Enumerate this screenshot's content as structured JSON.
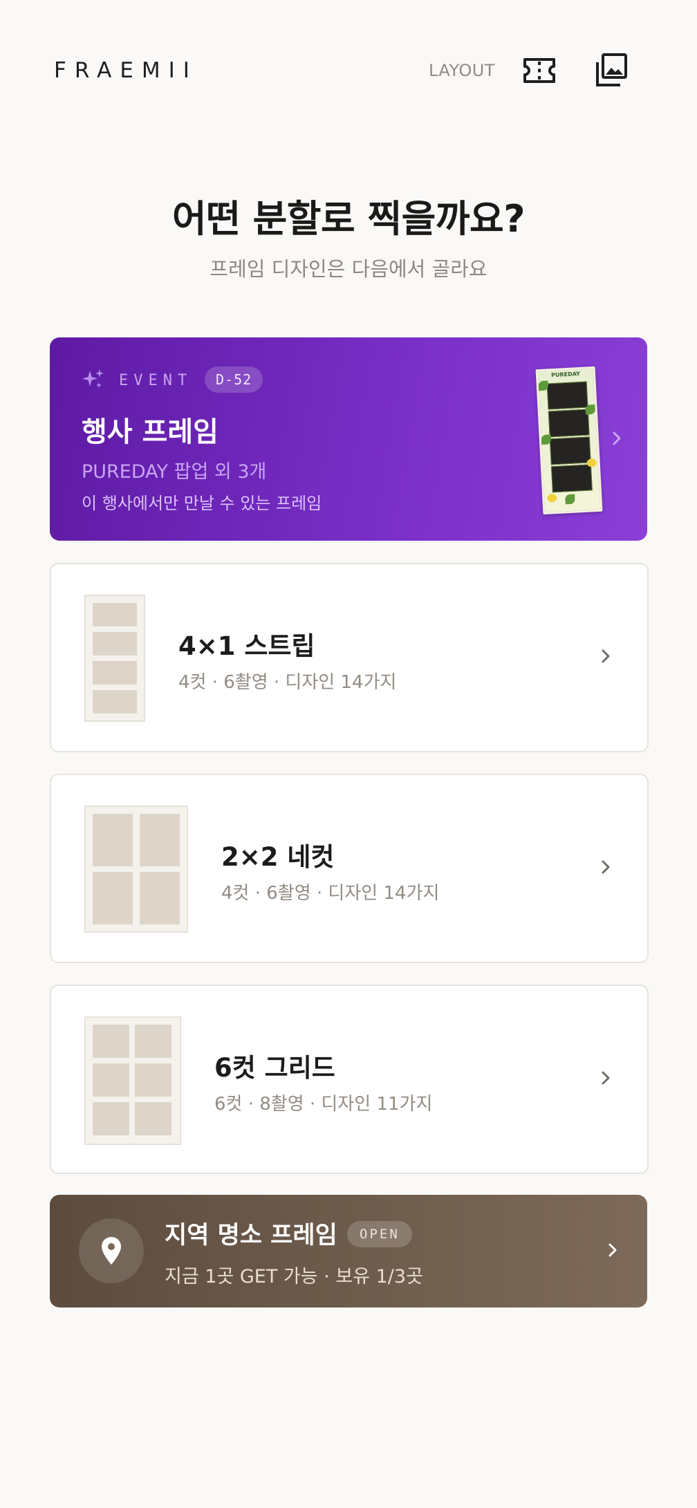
{
  "header": {
    "logo": "FRAEMII",
    "layout_link": "LAYOUT",
    "ticket_icon": "ticket-icon",
    "gallery_icon": "photo-gallery-icon"
  },
  "page": {
    "title": "어떤 분할로 찍을까요?",
    "subtitle": "프레임 디자인은 다음에서 골라요"
  },
  "event_card": {
    "tag": "EVENT",
    "dday": "D-52",
    "title": "행사 프레임",
    "subtitle": "PUREDAY 팝업 외 3개",
    "description": "이 행사에서만 만날 수 있는 프레임",
    "thumb_brand": "PUREDAY",
    "accent_color": "#6f26bd"
  },
  "layouts": [
    {
      "title": "4×1 스트립",
      "meta": "4컷 · 6촬영 · 디자인 14가지"
    },
    {
      "title": "2×2 네컷",
      "meta": "4컷 · 6촬영 · 디자인 14가지"
    },
    {
      "title": "6컷 그리드",
      "meta": "6컷 · 8촬영 · 디자인 11가지"
    }
  ],
  "local_card": {
    "title": "지역 명소 프레임",
    "badge": "OPEN",
    "meta": "지금 1곳 GET 가능 · 보유 1/3곳",
    "icon": "location-pin-icon",
    "accent_color": "#6b5a4b"
  }
}
